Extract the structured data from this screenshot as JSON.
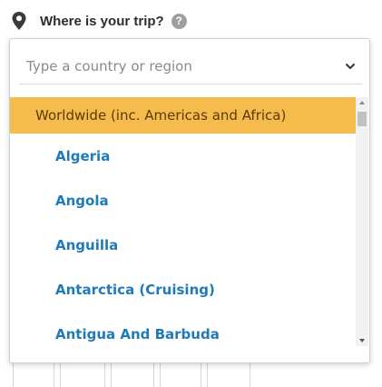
{
  "question": {
    "label": "Where is your trip?",
    "help": "?"
  },
  "search": {
    "placeholder": "Type a country or region",
    "value": ""
  },
  "options": [
    {
      "label": "Worldwide (inc. Americas and Africa)",
      "highlighted": true
    },
    {
      "label": "Algeria"
    },
    {
      "label": "Angola"
    },
    {
      "label": "Anguilla"
    },
    {
      "label": "Antarctica (Cruising)"
    },
    {
      "label": "Antigua And Barbuda"
    }
  ],
  "colors": {
    "highlight": "#f6bb4d",
    "link": "#1f7ab8"
  },
  "icons": [
    "map-pin-icon",
    "help-icon",
    "chevron-down-icon",
    "scroll-up-arrow-icon",
    "scroll-down-arrow-icon"
  ]
}
